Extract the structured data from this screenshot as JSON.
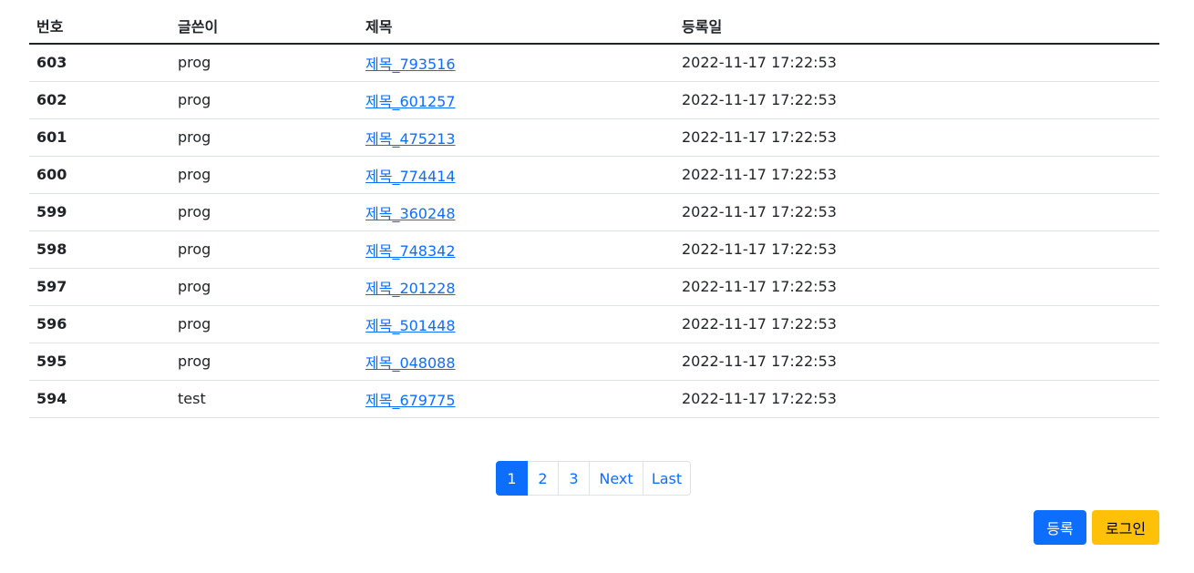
{
  "table": {
    "headers": {
      "num": "번호",
      "writer": "글쓴이",
      "title": "제목",
      "date": "등록일"
    },
    "rows": [
      {
        "num": "603",
        "writer": "prog",
        "title": "제목_793516",
        "date": "2022-11-17 17:22:53"
      },
      {
        "num": "602",
        "writer": "prog",
        "title": "제목_601257",
        "date": "2022-11-17 17:22:53"
      },
      {
        "num": "601",
        "writer": "prog",
        "title": "제목_475213",
        "date": "2022-11-17 17:22:53"
      },
      {
        "num": "600",
        "writer": "prog",
        "title": "제목_774414",
        "date": "2022-11-17 17:22:53"
      },
      {
        "num": "599",
        "writer": "prog",
        "title": "제목_360248",
        "date": "2022-11-17 17:22:53"
      },
      {
        "num": "598",
        "writer": "prog",
        "title": "제목_748342",
        "date": "2022-11-17 17:22:53"
      },
      {
        "num": "597",
        "writer": "prog",
        "title": "제목_201228",
        "date": "2022-11-17 17:22:53"
      },
      {
        "num": "596",
        "writer": "prog",
        "title": "제목_501448",
        "date": "2022-11-17 17:22:53"
      },
      {
        "num": "595",
        "writer": "prog",
        "title": "제목_048088",
        "date": "2022-11-17 17:22:53"
      },
      {
        "num": "594",
        "writer": "test",
        "title": "제목_679775",
        "date": "2022-11-17 17:22:53"
      }
    ]
  },
  "pagination": {
    "pages": [
      "1",
      "2",
      "3"
    ],
    "active_page": "1",
    "next_label": "Next",
    "last_label": "Last"
  },
  "actions": {
    "register_label": "등록",
    "login_label": "로그인"
  },
  "colors": {
    "primary": "#0d6efd",
    "warning": "#ffc107",
    "border": "#dee2e6",
    "text": "#212529"
  }
}
